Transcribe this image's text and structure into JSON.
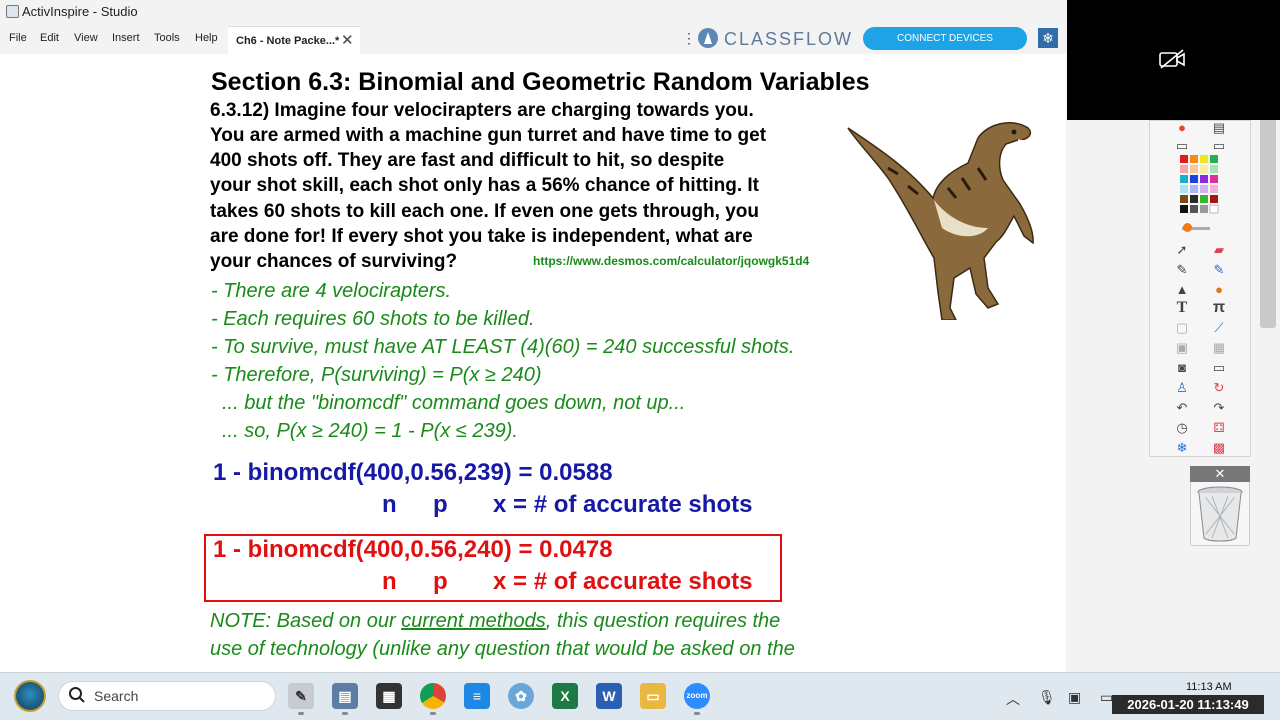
{
  "window": {
    "title": "ActivInspire - Studio"
  },
  "menu": {
    "items": [
      "File",
      "Edit",
      "View",
      "Insert",
      "Tools",
      "Help"
    ]
  },
  "tab": {
    "label": "Ch6 - Note Packe...*",
    "close": "✕"
  },
  "classflow": {
    "logo_text": "CLASSFLOW",
    "connect_label": "CONNECT DEVICES"
  },
  "page": {
    "section_title": "Section 6.3: Binomial and Geometric Random Variables",
    "question_lines": [
      "6.3.12) Imagine four velocirapters are charging towards you.",
      "You are armed with a machine gun turret and have time to get",
      "400 shots off. They are fast and difficult to hit, so despite",
      "your shot skill, each shot only has a 56% chance of hitting. It",
      "takes 60 shots to kill each one. If even one gets through, you",
      "are done for! If every shot you take is independent, what are",
      "your chances of surviving?"
    ],
    "desmos_link": "https://www.desmos.com/calculator/jqowgk51d4",
    "notes": [
      "- There are 4 velocirapters.",
      "- Each requires 60 shots to be killed.",
      "- To survive, must have AT LEAST (4)(60) = 240 successful shots.",
      "- Therefore, P(surviving) = P(x ≥ 240)",
      "   ... but the \"binomcdf\" command goes down, not up...",
      "   ... so, P(x ≥ 240) = 1 - P(x ≤ 239)."
    ],
    "blue_formula": "1 - binomcdf(400,0.56,239) = 0.0588",
    "blue_labels": {
      "n": "n",
      "p": "p",
      "x": "x = # of accurate shots"
    },
    "red_formula": "1 - binomcdf(400,0.56,240) = 0.0478",
    "red_labels": {
      "n": "n",
      "p": "p",
      "x": "x = # of accurate shots"
    },
    "note_line1_a": "NOTE: Based on our ",
    "note_line1_b": "current methods",
    "note_line1_c": ", this question requires the",
    "note_line2": "use of technology (unlike any question that would be asked on the"
  },
  "taskbar": {
    "search_placeholder": "Search",
    "time": "11:13 AM",
    "timestamp_overlay": "2026-01-20 11:13:49"
  },
  "colors": {
    "accent_blue": "#1ea3e6",
    "notes_green": "#1a8a1a",
    "formula_blue": "#1619a6",
    "formula_red": "#e01010"
  }
}
